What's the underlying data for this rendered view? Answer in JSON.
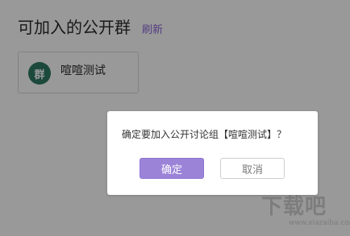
{
  "page": {
    "title": "可加入的公开群",
    "refresh_label": "刷新"
  },
  "group_card": {
    "avatar_text": "群",
    "name": "喧喧测试"
  },
  "dialog": {
    "message": "确定要加入公开讨论组【喧喧测试】？",
    "confirm_label": "确定",
    "cancel_label": "取消"
  },
  "watermark": {
    "text": "下载吧",
    "subtext": "www.xiazaiba.com"
  },
  "colors": {
    "accent": "#8a67d9",
    "avatar_bg": "#2f7a63",
    "confirm_bg": "#9b84d8"
  }
}
